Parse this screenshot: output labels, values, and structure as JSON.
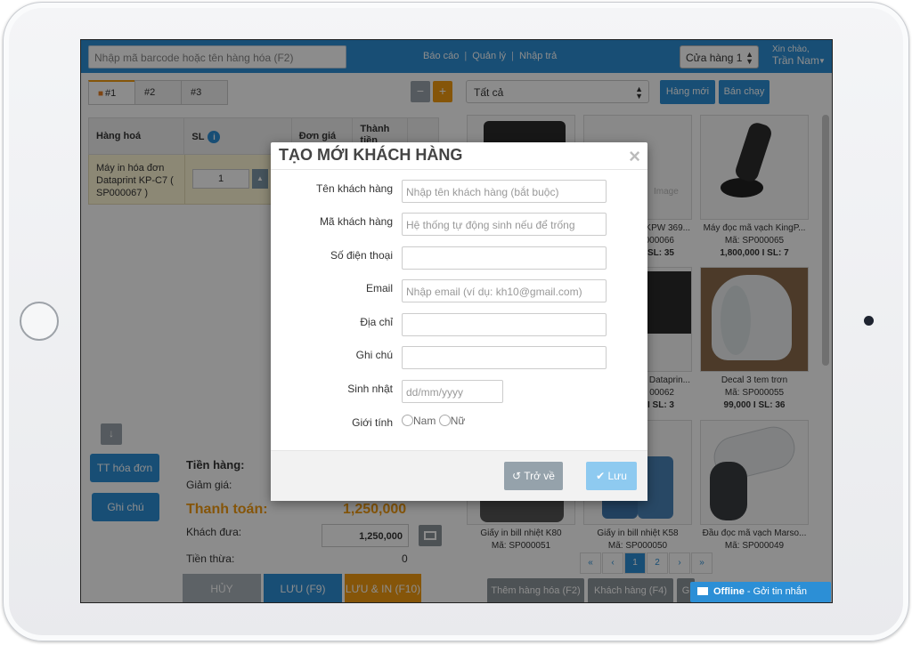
{
  "search": {
    "placeholder": "Nhập mã barcode hoặc tên hàng hóa (F2)"
  },
  "nav": {
    "items": [
      "Báo cáo",
      "Quản lý",
      "Nhập trả"
    ],
    "separator": "|"
  },
  "store": {
    "value": "Cửa hàng 1"
  },
  "user": {
    "greeting": "Xin chào,",
    "name": "Trần Nam"
  },
  "tabs": [
    {
      "label": "#1"
    },
    {
      "label": "#2"
    },
    {
      "label": "#3"
    }
  ],
  "controls": {
    "minus": "−",
    "plus": "+"
  },
  "cart": {
    "headers": {
      "product": "Hàng hoá",
      "qty": "SL",
      "unit_price": "Đơn giá",
      "total": "Thành tiền"
    },
    "rows": [
      {
        "name": "Máy in hóa đơn Dataprint KP-C7 ( SP000067 )",
        "qty": "1"
      }
    ]
  },
  "side_buttons": {
    "invoice_info": "TT hóa đơn",
    "note": "Ghi chú"
  },
  "summary": {
    "goods_label": "Tiền hàng:",
    "discount_label": "Giảm giá:",
    "pay_label": "Thanh toán:",
    "pay_value": "1,250,000",
    "customer_paid_label": "Khách đưa:",
    "customer_paid_value": "1,250,000",
    "change_label": "Tiền thừa:",
    "change_value": "0"
  },
  "actions": {
    "cancel": "HỦY",
    "save": "LƯU (F9)",
    "save_print": "LƯU & IN (F10)"
  },
  "catalog": {
    "category": "Tất cả",
    "new_button": "Hàng mới",
    "bestseller_button": "Bán chạy",
    "products": [
      {
        "title": "",
        "code": "",
        "price": ""
      },
      {
        "title": "KPW 369...",
        "code": "000066",
        "price": "I SL: 35"
      },
      {
        "title": "Máy đọc mã vạch KingP...",
        "code": "Mã: SP000065",
        "price": "1,800,000 I SL: 7"
      },
      {
        "title": "",
        "code": "",
        "price": ""
      },
      {
        "title": "n Dataprin...",
        "code": "00062",
        "price": "I SL: 3"
      },
      {
        "title": "Decal 3 tem trơn",
        "code": "Mã: SP000055",
        "price": "99,000 I SL: 36"
      },
      {
        "title": "Giấy in bill nhiệt K80",
        "code": "Mã: SP000051",
        "price": ""
      },
      {
        "title": "Giấy in bill nhiệt K58",
        "code": "Mã: SP000050",
        "price": ""
      },
      {
        "title": "Đầu đọc mã vạch Marso...",
        "code": "Mã: SP000049",
        "price": ""
      }
    ],
    "no_image_text": "Image",
    "pager": [
      "«",
      "‹",
      "1",
      "2",
      "›",
      "»"
    ],
    "footer_buttons": [
      "Thêm hàng hóa (F2)",
      "Khách hàng (F4)",
      "G"
    ]
  },
  "chat": {
    "status": "Offline",
    "action": "Gởi tin nhắn"
  },
  "modal": {
    "title": "TẠO MỚI KHÁCH HÀNG",
    "close": "×",
    "fields": [
      {
        "label": "Tên khách hàng",
        "placeholder": "Nhập tên khách hàng (bắt buộc)"
      },
      {
        "label": "Mã khách hàng",
        "placeholder": "Hệ thống tự động sinh nếu để trống"
      },
      {
        "label": "Số điện thoại",
        "placeholder": ""
      },
      {
        "label": "Email",
        "placeholder": "Nhập email (ví dụ: kh10@gmail.com)"
      },
      {
        "label": "Địa chỉ",
        "placeholder": ""
      },
      {
        "label": "Ghi chú",
        "placeholder": ""
      },
      {
        "label": "Sinh nhật",
        "placeholder": "dd/mm/yyyy"
      }
    ],
    "gender": {
      "label": "Giới tính",
      "male": "Nam",
      "female": "Nữ"
    },
    "back_button": "Trở về",
    "save_button": "Lưu"
  },
  "colors": {
    "primary": "#2c8fd6",
    "accent": "#f39c12"
  }
}
